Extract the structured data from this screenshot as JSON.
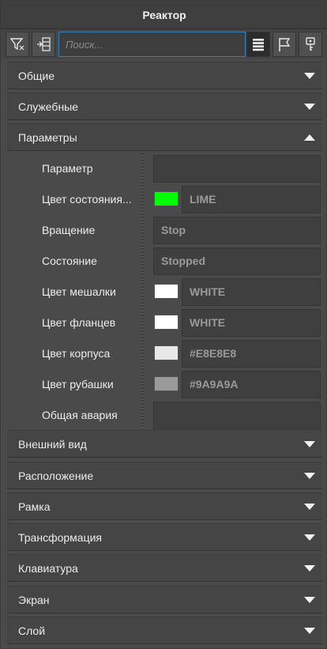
{
  "window": {
    "title": "Реактор"
  },
  "toolbar": {
    "filter_icon": "filter-icon",
    "sort_icon": "sort-icon",
    "search_placeholder": "Поиск...",
    "list_icon": "list-icon",
    "flag_icon": "flag-icon",
    "key_icon": "key-icon"
  },
  "sections_top": [
    {
      "label": "Общие",
      "expanded": false
    },
    {
      "label": "Служебные",
      "expanded": false
    },
    {
      "label": "Параметры",
      "expanded": true
    }
  ],
  "properties": [
    {
      "label": "Параметр",
      "value": "",
      "color": null
    },
    {
      "label": "Цвет состояния...",
      "value": "LIME",
      "color": "#00FF00"
    },
    {
      "label": "Вращение",
      "value": "Stop",
      "color": null
    },
    {
      "label": "Состояние",
      "value": "Stopped",
      "color": null
    },
    {
      "label": "Цвет мешалки",
      "value": "WHITE",
      "color": "#FFFFFF"
    },
    {
      "label": "Цвет фланцев",
      "value": "WHITE",
      "color": "#FFFFFF"
    },
    {
      "label": "Цвет корпуса",
      "value": "#E8E8E8",
      "color": "#E8E8E8"
    },
    {
      "label": "Цвет рубашки",
      "value": "#9A9A9A",
      "color": "#9A9A9A"
    },
    {
      "label": "Общая авария",
      "value": "",
      "color": null
    }
  ],
  "sections_bottom": [
    {
      "label": "Внешний вид",
      "expanded": false
    },
    {
      "label": "Расположение",
      "expanded": false
    },
    {
      "label": "Рамка",
      "expanded": false
    },
    {
      "label": "Трансформация",
      "expanded": false
    },
    {
      "label": "Клавиатура",
      "expanded": false
    },
    {
      "label": "Экран",
      "expanded": false
    },
    {
      "label": "Слой",
      "expanded": false
    }
  ],
  "colors": {
    "background": "#4A4A4A",
    "header": "#454545",
    "accent": "#3A7FB8",
    "text": "#ECECEC",
    "muted_value": "#9A9A9A"
  }
}
